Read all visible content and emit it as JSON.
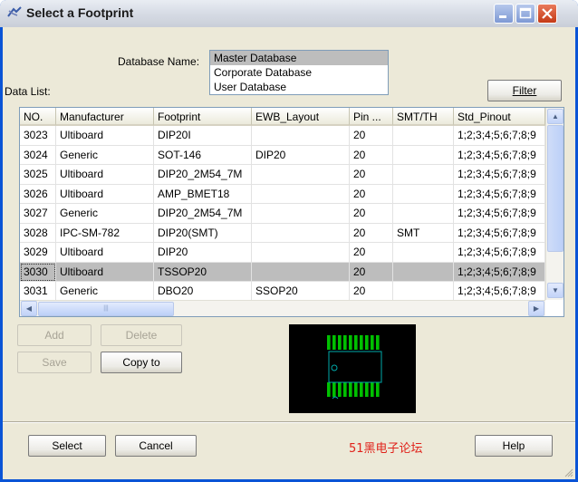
{
  "window": {
    "title": "Select a Footprint"
  },
  "database": {
    "label": "Database Name:",
    "options": [
      {
        "label": "Master Database",
        "selected": true
      },
      {
        "label": "Corporate Database",
        "selected": false
      },
      {
        "label": "User Database",
        "selected": false
      }
    ]
  },
  "data_list_label": "Data List:",
  "filter_label": "Filter",
  "table": {
    "columns": [
      "NO.",
      "Manufacturer",
      "Footprint",
      "EWB_Layout",
      "Pin ...",
      "SMT/TH",
      "Std_Pinout"
    ],
    "rows": [
      [
        "3023",
        "Ultiboard",
        "DIP20I",
        "",
        "20",
        "",
        "1;2;3;4;5;6;7;8;9"
      ],
      [
        "3024",
        "Generic",
        "SOT-146",
        "DIP20",
        "20",
        "",
        "1;2;3;4;5;6;7;8;9"
      ],
      [
        "3025",
        "Ultiboard",
        "DIP20_2M54_7M",
        "",
        "20",
        "",
        "1;2;3;4;5;6;7;8;9"
      ],
      [
        "3026",
        "Ultiboard",
        "AMP_BMET18",
        "",
        "20",
        "",
        "1;2;3;4;5;6;7;8;9"
      ],
      [
        "3027",
        "Generic",
        "DIP20_2M54_7M",
        "",
        "20",
        "",
        "1;2;3;4;5;6;7;8;9"
      ],
      [
        "3028",
        "IPC-SM-782",
        "DIP20(SMT)",
        "",
        "20",
        "SMT",
        "1;2;3;4;5;6;7;8;9"
      ],
      [
        "3029",
        "Ultiboard",
        "DIP20",
        "",
        "20",
        "",
        "1;2;3;4;5;6;7;8;9"
      ],
      [
        "3030",
        "Ultiboard",
        "TSSOP20",
        "",
        "20",
        "",
        "1;2;3;4;5;6;7;8;9"
      ],
      [
        "3031",
        "Generic",
        "DBO20",
        "SSOP20",
        "20",
        "",
        "1;2;3;4;5;6;7;8;9"
      ]
    ],
    "selected_row": 7
  },
  "buttons": {
    "add": "Add",
    "delete": "Delete",
    "save": "Save",
    "copy_to": "Copy to",
    "select": "Select",
    "cancel": "Cancel",
    "help": "Help"
  },
  "watermark": "51黑电子论坛",
  "colors": {
    "title_bar": "#d8dde6",
    "dialog_bg": "#ece9d8",
    "selection": "#bdbdbd",
    "preview_bg": "#000000",
    "preview_pads": "#00c000",
    "preview_outline": "#00aaaa",
    "watermark": "#e0231b",
    "close_button": "#c43a17"
  }
}
